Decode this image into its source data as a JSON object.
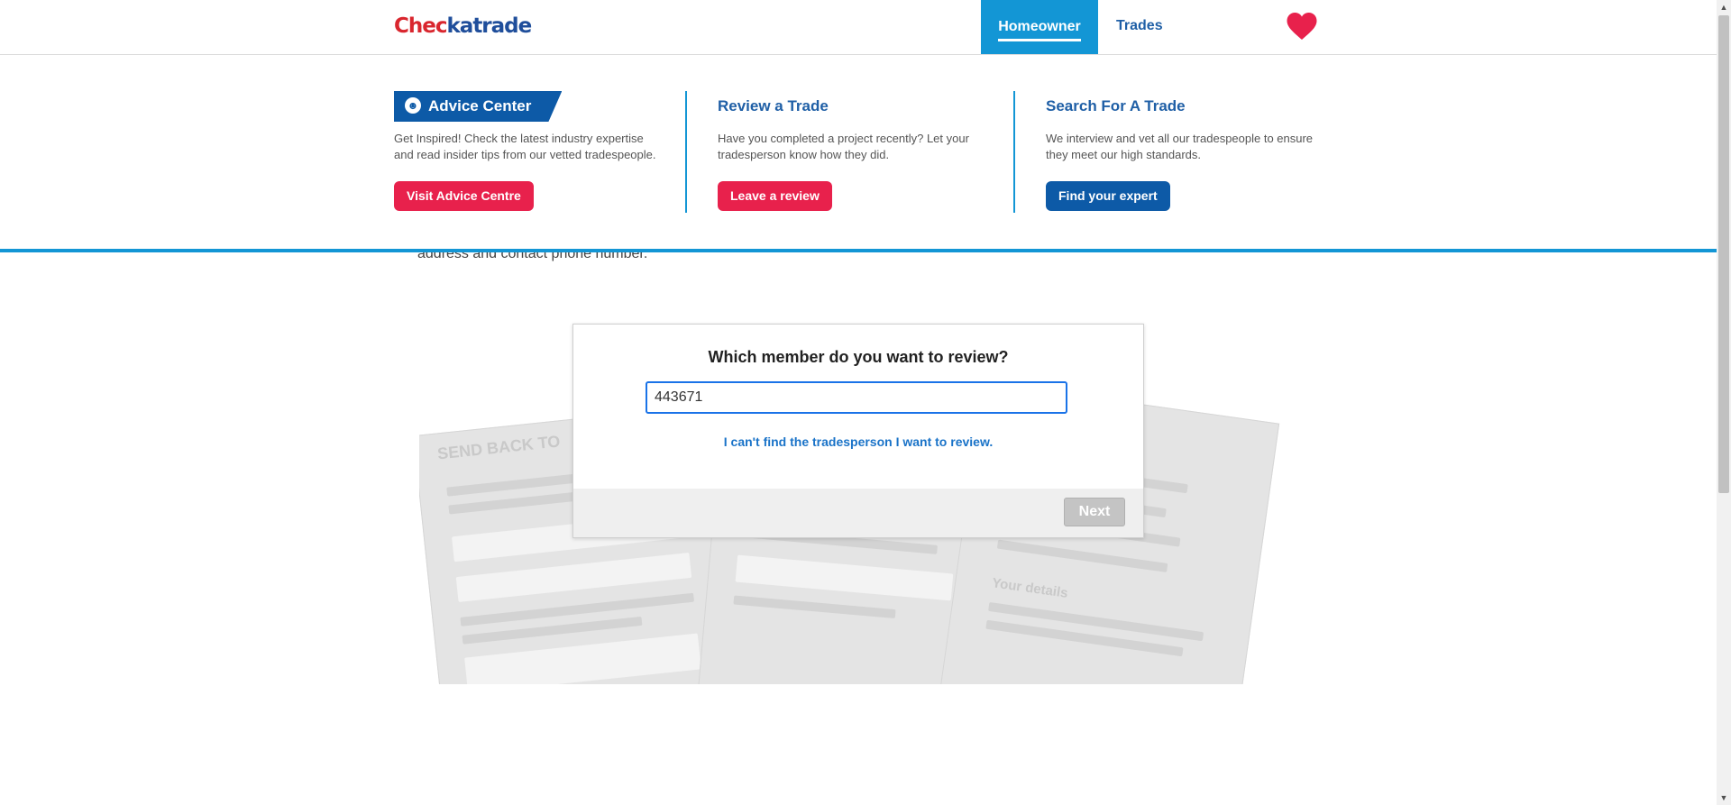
{
  "header": {
    "logo": {
      "part1": "Chec",
      "part2": "katrade"
    },
    "nav": {
      "homeowner": "Homeowner",
      "trades": "Trades"
    }
  },
  "mega_menu": {
    "advice": {
      "tag": "Advice Center",
      "text": "Get Inspired! Check the latest industry expertise and read insider tips from our vetted tradespeople.",
      "button": "Visit Advice Centre"
    },
    "review": {
      "title": "Review a Trade",
      "text": "Have you completed a project recently? Let your tradesperson know how they did.",
      "button": "Leave a review"
    },
    "search": {
      "title": "Search For A Trade",
      "text": "We interview and vet all our tradespeople to ensure they meet our high standards.",
      "button": "Find your expert"
    }
  },
  "page": {
    "partial_text": "address and contact phone number."
  },
  "modal": {
    "title": "Which member do you want to review?",
    "input_value": "443671",
    "link": "I can't find the tradesperson I want to review.",
    "next_button": "Next"
  },
  "colors": {
    "brand_blue": "#1396d5",
    "brand_red": "#e8214c",
    "dark_blue": "#0d5aa7"
  }
}
